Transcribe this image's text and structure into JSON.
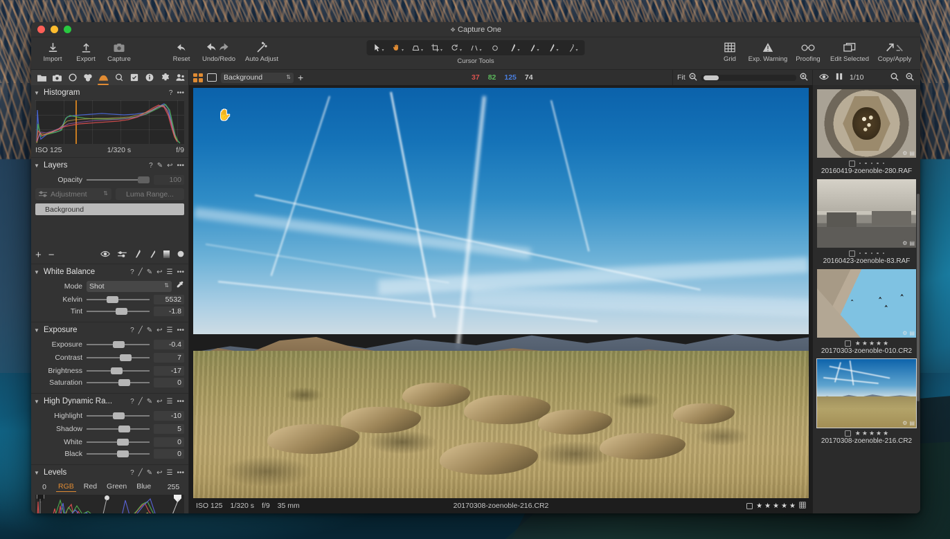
{
  "window": {
    "title": "Capture One",
    "title_icon": "app-icon"
  },
  "toolbar": {
    "left_buttons": [
      {
        "label": "Import",
        "icon": "import-arrow-down-icon"
      },
      {
        "label": "Export",
        "icon": "export-arrow-up-icon"
      },
      {
        "label": "Capture",
        "icon": "camera-icon"
      }
    ],
    "edit_buttons": [
      {
        "label": "Reset",
        "icon": "reset-arrow-icon"
      },
      {
        "label": "Undo/Redo",
        "icon": "undo-redo-icon"
      },
      {
        "label": "Auto Adjust",
        "icon": "magic-wand-icon"
      }
    ],
    "cursor_tools_label": "Cursor Tools",
    "cursor_tools": [
      {
        "name": "select-pointer-tool",
        "active": false
      },
      {
        "name": "pan-hand-tool",
        "active": true
      },
      {
        "name": "crop-shape-tool",
        "active": false
      },
      {
        "name": "crop-tool",
        "active": false
      },
      {
        "name": "rotate-tool",
        "active": false
      },
      {
        "name": "keystone-tool",
        "active": false
      },
      {
        "name": "spot-removal-tool",
        "active": false
      },
      {
        "name": "draw-mask-brush-tool",
        "active": false
      },
      {
        "name": "erase-mask-tool",
        "active": false
      },
      {
        "name": "gradient-mask-tool",
        "active": false
      },
      {
        "name": "heal-brush-tool",
        "active": false
      }
    ],
    "right_buttons": [
      {
        "label": "Grid",
        "icon": "grid-icon"
      },
      {
        "label": "Exp. Warning",
        "icon": "warning-triangle-icon"
      },
      {
        "label": "Proofing",
        "icon": "glasses-icon"
      },
      {
        "label": "Edit Selected",
        "icon": "stacked-layers-icon"
      },
      {
        "label": "Copy/Apply",
        "icon": "copy-apply-arrows-icon"
      }
    ]
  },
  "tool_tabs": [
    {
      "name": "library-tab",
      "icon": "folder-icon",
      "selected": false
    },
    {
      "name": "capture-tab",
      "icon": "camera-icon",
      "selected": false
    },
    {
      "name": "lens-tab",
      "icon": "lens-circle-icon",
      "selected": false
    },
    {
      "name": "color-tab",
      "icon": "color-wheels-icon",
      "selected": false
    },
    {
      "name": "exposure-tab",
      "icon": "exposure-hill-icon",
      "selected": true
    },
    {
      "name": "details-tab",
      "icon": "magnifier-icon",
      "selected": false
    },
    {
      "name": "adjustments-tab",
      "icon": "checklist-icon",
      "selected": false
    },
    {
      "name": "metadata-tab",
      "icon": "info-icon",
      "selected": false
    },
    {
      "name": "output-tab",
      "icon": "gear-icon",
      "selected": false
    },
    {
      "name": "batch-tab",
      "icon": "batch-people-icon",
      "selected": false
    }
  ],
  "viewer_bar": {
    "grid_view_icon": "grid-view-icon",
    "single_view_icon": "single-view-icon",
    "variant_selected": "Background",
    "add_variant_icon": "plus-icon",
    "readout": {
      "r": "37",
      "g": "82",
      "b": "125",
      "k": "74"
    }
  },
  "zoom_bar": {
    "fit_label": "Fit",
    "zoom_out_icon": "magnifier-minus-icon",
    "zoom_in_icon": "magnifier-plus-icon"
  },
  "right_bar": {
    "eye_icon": "eye-icon",
    "compare_icon": "compare-split-icon",
    "ratio_label": "1/10",
    "search_icon": "magnifier-icon",
    "search2_icon": "magnifier-plus-icon"
  },
  "tools": {
    "histogram": {
      "title": "Histogram",
      "help_icon": "help-question-icon",
      "more_icon": "more-dots-icon",
      "iso": "ISO 125",
      "shutter": "1/320 s",
      "aperture": "f/9"
    },
    "layers": {
      "title": "Layers",
      "icons": [
        "help-question-icon",
        "pick-icon",
        "reset-arrow-icon",
        "more-dots-icon"
      ],
      "opacity_label": "Opacity",
      "opacity_value": "100",
      "adjustment_label": "Adjustment",
      "luma_range_label": "Luma Range...",
      "layer_items": [
        "Background"
      ],
      "footer_icons": [
        "add-layer-icon",
        "remove-layer-icon",
        "eye-icon",
        "fill-mask-icon",
        "draw-mask-icon",
        "erase-mask-icon",
        "linear-gradient-icon",
        "radial-gradient-icon"
      ]
    },
    "white_balance": {
      "title": "White Balance",
      "icons": [
        "help-question-icon",
        "slider-reset-icon",
        "pick-icon",
        "reset-arrow-icon",
        "menu-icon",
        "more-dots-icon"
      ],
      "mode_label": "Mode",
      "mode_value": "Shot",
      "picker_icon": "eyedropper-icon",
      "sliders": [
        {
          "label": "Kelvin",
          "value": "5532",
          "pos": 32
        },
        {
          "label": "Tint",
          "value": "-1.8",
          "pos": 46
        }
      ]
    },
    "exposure": {
      "title": "Exposure",
      "icons": [
        "help-question-icon",
        "slider-reset-icon",
        "pick-icon",
        "reset-arrow-icon",
        "menu-icon",
        "more-dots-icon"
      ],
      "sliders": [
        {
          "label": "Exposure",
          "value": "-0.4",
          "pos": 42
        },
        {
          "label": "Contrast",
          "value": "7",
          "pos": 53
        },
        {
          "label": "Brightness",
          "value": "-17",
          "pos": 38
        },
        {
          "label": "Saturation",
          "value": "0",
          "pos": 50
        }
      ]
    },
    "hdr": {
      "title": "High Dynamic Ra...",
      "icons": [
        "help-question-icon",
        "slider-reset-icon",
        "pick-icon",
        "reset-arrow-icon",
        "menu-icon",
        "more-dots-icon"
      ],
      "sliders": [
        {
          "label": "Highlight",
          "value": "-10",
          "pos": 42
        },
        {
          "label": "Shadow",
          "value": "5",
          "pos": 50
        },
        {
          "label": "White",
          "value": "0",
          "pos": 48
        },
        {
          "label": "Black",
          "value": "0",
          "pos": 48
        }
      ]
    },
    "levels": {
      "title": "Levels",
      "icons": [
        "help-question-icon",
        "slider-reset-icon",
        "pick-icon",
        "reset-arrow-icon",
        "menu-icon",
        "more-dots-icon"
      ],
      "min_value": "0",
      "max_value": "255",
      "channels": [
        {
          "label": "RGB",
          "active": true
        },
        {
          "label": "Red",
          "active": false
        },
        {
          "label": "Green",
          "active": false
        },
        {
          "label": "Blue",
          "active": false
        }
      ]
    }
  },
  "viewer_footer": {
    "iso": "ISO 125",
    "shutter": "1/320 s",
    "aperture": "f/9",
    "focal": "35 mm",
    "filename": "20170308-zoenoble-216.CR2",
    "rating_stars": 5,
    "checkbox_icon": "color-tag-checkbox",
    "grid_icon": "grid-small-icon"
  },
  "browser": {
    "thumbnails": [
      {
        "name": "20160419-zoenoble-280.RAF",
        "rating": 0,
        "dots": 5,
        "selected": false,
        "art": "t1"
      },
      {
        "name": "20160423-zoenoble-83.RAF",
        "rating": 0,
        "dots": 5,
        "selected": false,
        "art": "t2"
      },
      {
        "name": "20170303-zoenoble-010.CR2",
        "rating": 5,
        "dots": 0,
        "selected": false,
        "art": "t3"
      },
      {
        "name": "20170308-zoenoble-216.CR2",
        "rating": 5,
        "dots": 0,
        "selected": true,
        "art": "t4"
      }
    ]
  },
  "colors": {
    "accent": "#e08b33",
    "panel": "#333333",
    "toolbar": "#323232",
    "viewer_bg": "#1d1d1d"
  }
}
